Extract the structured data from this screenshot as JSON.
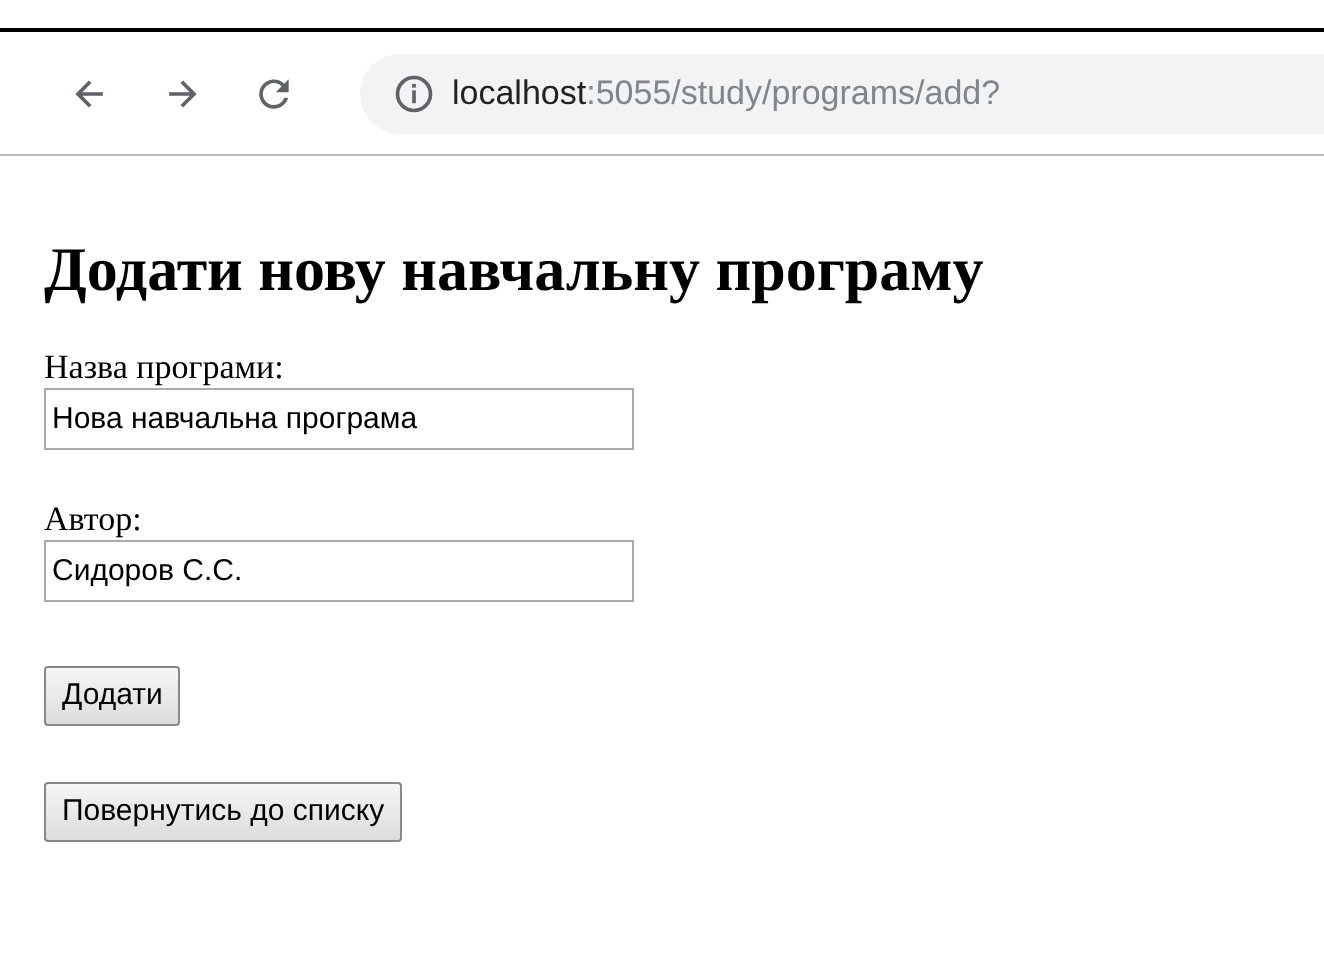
{
  "browser": {
    "url_host": "localhost",
    "url_path": ":5055/study/programs/add?"
  },
  "heading": "Додати нову навчальну програму",
  "fields": [
    {
      "label": "Назва програми:",
      "value": "Нова навчальна програма"
    },
    {
      "label": "Автор:",
      "value": "Сидоров С.С."
    }
  ],
  "buttons": [
    {
      "label": "Додати"
    },
    {
      "label": "Повернутись до списку"
    }
  ]
}
